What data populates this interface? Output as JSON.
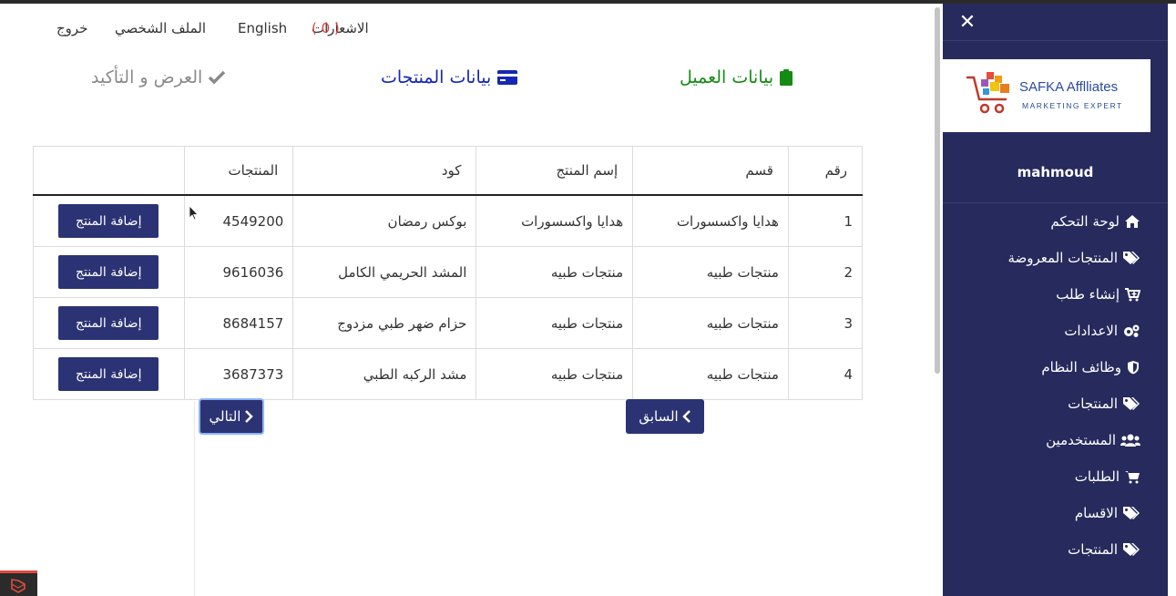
{
  "topnav": {
    "logout": "خروج",
    "profile": "الملف الشخصي",
    "english": "English",
    "notifications_label": "الاشعارات",
    "notifications_count": "( 0 )"
  },
  "steps": {
    "client": "بيانات العميل",
    "products": "بيانات المنتجات",
    "confirm": "العرض و التأكيد"
  },
  "table": {
    "headers": {
      "number": "رقم",
      "category": "قسم",
      "product_name": "إسم المنتج",
      "code": "كود",
      "products": "المنتجات"
    },
    "add_label": "إضافة المنتج",
    "rows": [
      {
        "number": "1",
        "category": "هدايا واكسسورات",
        "product_name": "هدايا واكسسورات",
        "code": "بوكس رمضان",
        "products": "4549200"
      },
      {
        "number": "2",
        "category": "منتجات طبيه",
        "product_name": "منتجات طبيه",
        "code": "المشد الحريمي الكامل",
        "products": "9616036"
      },
      {
        "number": "3",
        "category": "منتجات طبيه",
        "product_name": "منتجات طبيه",
        "code": "حزام ضهر طبي مزدوج",
        "products": "8684157"
      },
      {
        "number": "4",
        "category": "منتجات طبيه",
        "product_name": "منتجات طبيه",
        "code": "مشد الركبه الطبي",
        "products": "3687373"
      }
    ]
  },
  "pager": {
    "next": "التالي",
    "previous": "السابق"
  },
  "sidebar": {
    "logo_brand": "SAFKA Afflliates",
    "logo_tagline": "MARKETING EXPERT",
    "username": "mahmoud",
    "items": [
      {
        "label": "لوحة التحكم",
        "icon": "home-icon"
      },
      {
        "label": "المنتجات المعروضة",
        "icon": "tags-icon"
      },
      {
        "label": "إنشاء طلب",
        "icon": "cart-plus-icon"
      },
      {
        "label": "الاعدادات",
        "icon": "cogs-icon"
      },
      {
        "label": "وظائف النظام",
        "icon": "shield-icon"
      },
      {
        "label": "المنتجات",
        "icon": "tags-icon"
      },
      {
        "label": "المستخدمين",
        "icon": "users-icon"
      },
      {
        "label": "الطلبات",
        "icon": "cart-icon"
      },
      {
        "label": "الاقسام",
        "icon": "tags-icon"
      },
      {
        "label": "المنتجات",
        "icon": "tags-icon"
      }
    ]
  },
  "colors": {
    "sidebar_bg": "#262a5c",
    "button_bg": "#2c3374",
    "step_client": "#148c14",
    "step_products": "#1428b4",
    "step_confirm": "#8a8a8a",
    "notif_count": "#e04040"
  }
}
